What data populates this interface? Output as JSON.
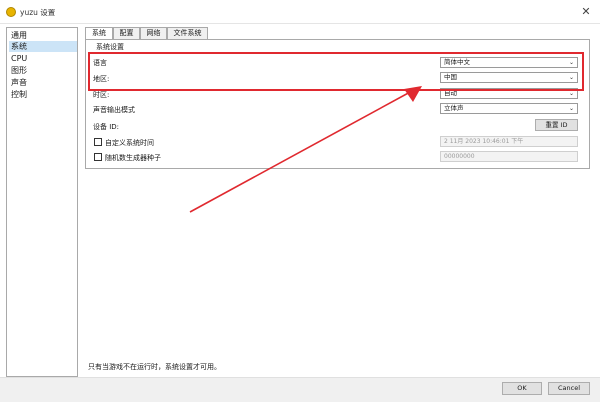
{
  "window": {
    "title": "yuzu 设置",
    "close_glyph": "✕"
  },
  "nav": {
    "items": [
      {
        "label": "通用",
        "selected": false
      },
      {
        "label": "系统",
        "selected": true
      },
      {
        "label": "CPU",
        "selected": false
      },
      {
        "label": "图形",
        "selected": false
      },
      {
        "label": "声音",
        "selected": false
      },
      {
        "label": "控制",
        "selected": false
      }
    ]
  },
  "tabs": [
    {
      "label": "系统",
      "active": true
    },
    {
      "label": "配置",
      "active": false
    },
    {
      "label": "网络",
      "active": false
    },
    {
      "label": "文件系统",
      "active": false
    }
  ],
  "system_settings": {
    "group_title": "系统设置",
    "language": {
      "label": "语言",
      "value": "简体中文"
    },
    "region": {
      "label": "地区:",
      "value": "中国"
    },
    "timezone": {
      "label": "时区:",
      "value": "自动"
    },
    "sound_output": {
      "label": "声音输出模式",
      "value": "立体声"
    },
    "device_id": {
      "label": "设备 ID:",
      "regenerate_label": "重置 ID"
    },
    "custom_rtc": {
      "label": "自定义系统时间",
      "checked": false,
      "value": "2 11月 2023 10:46:01 下午"
    },
    "rng_seed": {
      "label": "随机数生成器种子",
      "checked": false,
      "value": "00000000"
    }
  },
  "footer_note": "只有当游戏不在运行时，系统设置才可用。",
  "buttons": {
    "ok": "OK",
    "cancel": "Cancel"
  },
  "colors": {
    "highlight": "#e0292f",
    "selected_row": "#cce4f7"
  }
}
